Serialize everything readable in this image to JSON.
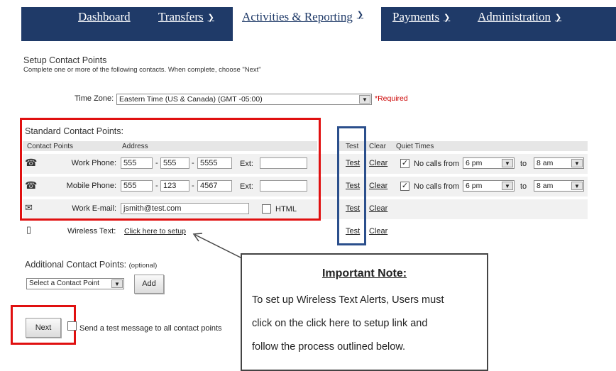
{
  "nav": {
    "tabs": [
      {
        "label": "Dashboard",
        "dropdown": false
      },
      {
        "label": "Transfers",
        "dropdown": true
      },
      {
        "label": "Activities & Reporting",
        "dropdown": true,
        "active": true
      },
      {
        "label": "Payments",
        "dropdown": true
      },
      {
        "label": "Administration",
        "dropdown": true
      }
    ]
  },
  "page": {
    "title": "Setup Contact Points",
    "subtitle": "Complete one or more of the following contacts. When complete, choose \"Next\""
  },
  "timezone": {
    "label": "Time Zone:",
    "value": "Eastern Time (US & Canada) (GMT -05:00)",
    "required": "*Required"
  },
  "standard": {
    "title": "Standard Contact Points:",
    "headers": {
      "contact_points": "Contact Points",
      "address": "Address",
      "test": "Test",
      "clear": "Clear",
      "quiet_times": "Quiet Times"
    },
    "work_phone": {
      "label": "Work Phone:",
      "area": "555",
      "prefix": "555",
      "line": "5555",
      "ext_label": "Ext:",
      "ext": "",
      "no_calls": "No calls from",
      "from": "6 pm",
      "to_label": "to",
      "to": "8 am"
    },
    "mobile_phone": {
      "label": "Mobile Phone:",
      "area": "555",
      "prefix": "123",
      "line": "4567",
      "ext_label": "Ext:",
      "ext": "",
      "no_calls": "No calls from",
      "from": "6 pm",
      "to_label": "to",
      "to": "8 am"
    },
    "work_email": {
      "label": "Work E-mail:",
      "value": "jsmith@test.com",
      "html_label": "HTML"
    },
    "wireless": {
      "label": "Wireless Text:",
      "link": "Click here to setup"
    },
    "test_link": "Test",
    "clear_link": "Clear",
    "dash": "-"
  },
  "additional": {
    "title": "Additional Contact Points:",
    "optional": "(optional)",
    "select": "Select a Contact Point",
    "add_button": "Add"
  },
  "footer": {
    "next_button": "Next",
    "test_all": "Send a test message to all contact points"
  },
  "note": {
    "title": "Important Note:",
    "lines": [
      "To set up Wireless Text Alerts, Users must",
      "click on the click here to setup link and",
      "follow the process outlined below."
    ]
  },
  "colors": {
    "nav_bg": "#1f3a68",
    "highlight_red": "#e01010",
    "highlight_blue": "#2b4f8c",
    "required": "#cc0000"
  }
}
